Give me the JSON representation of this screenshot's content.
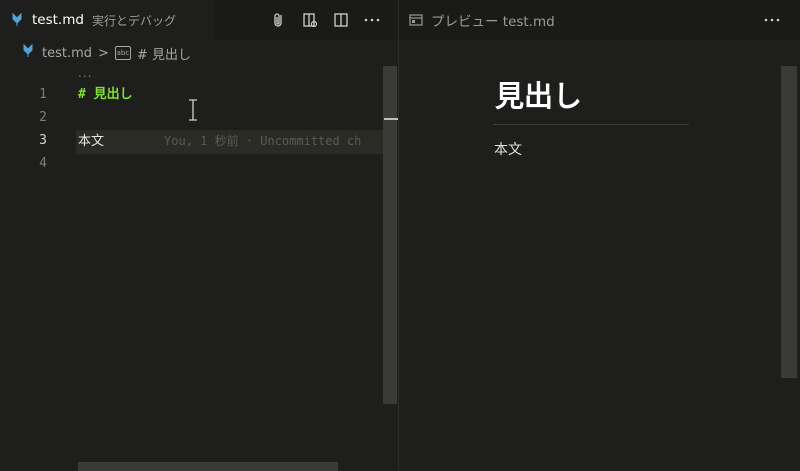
{
  "editor": {
    "tab": {
      "filename": "test.md",
      "description": "実行とデバッグ",
      "icon": "markdown-icon"
    },
    "actions": [
      "attach-icon",
      "open-preview-icon",
      "split-editor-icon",
      "more-icon"
    ],
    "breadcrumb": {
      "file": "test.md",
      "separator": ">",
      "symbol_icon": "abc",
      "heading": "# 見出し"
    },
    "sticky_marker": "...",
    "lines": [
      {
        "number": "1",
        "text": "# 見出し"
      },
      {
        "number": "2",
        "text": ""
      },
      {
        "number": "3",
        "text": "本文",
        "blame": "You, 1 秒前 · Uncommitted ch"
      },
      {
        "number": "4",
        "text": ""
      }
    ],
    "active_line": "3"
  },
  "preview": {
    "tab": {
      "title": "プレビュー test.md",
      "icon": "preview-icon"
    },
    "actions": [
      "more-icon"
    ],
    "heading": "見出し",
    "body": "本文"
  },
  "colors": {
    "heading_markdown": "#7ee030",
    "background": "#1e1e1c"
  }
}
